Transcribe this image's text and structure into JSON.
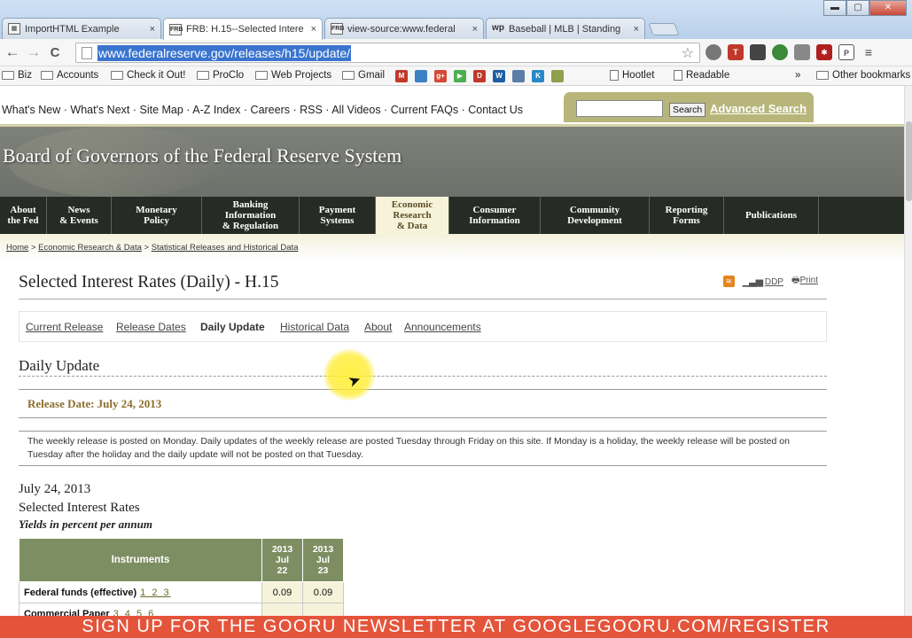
{
  "browser": {
    "tabs": [
      {
        "icon": "▦",
        "title": "ImportHTML Example",
        "close": "×"
      },
      {
        "icon": "FRB",
        "title": "FRB: H.15--Selected Intere",
        "close": "×"
      },
      {
        "icon": "FRB",
        "title": "view-source:www.federal",
        "close": "×"
      },
      {
        "icon": "wp",
        "title": "Baseball | MLB | Standing",
        "close": "×"
      }
    ],
    "window_controls": {
      "minimize": "▬",
      "maximize": "▢",
      "close": "✕"
    },
    "nav": {
      "back": "←",
      "forward": "→",
      "reload": "C"
    },
    "url": "www.federalreserve.gov/releases/h15/update/",
    "star": "☆",
    "bookmarks": [
      {
        "label": "Biz"
      },
      {
        "label": "Accounts"
      },
      {
        "label": "Check it Out!"
      },
      {
        "label": "ProClo"
      },
      {
        "label": "Web Projects"
      },
      {
        "label": "Gmail"
      },
      {
        "label": "Hootlet"
      },
      {
        "label": "Readable"
      },
      {
        "label": "»"
      },
      {
        "label": "Other bookmarks"
      }
    ]
  },
  "site": {
    "utility_links": "What's New · What's Next · Site Map · A-Z Index · Careers · RSS · All Videos · Current FAQs · Contact Us",
    "search_button": "Search",
    "advanced_search": "Advanced Search",
    "title": "Board of Governors of the Federal Reserve System",
    "nav": [
      {
        "label": "About\nthe Fed"
      },
      {
        "label": "News\n& Events"
      },
      {
        "label": "Monetary\nPolicy"
      },
      {
        "label": "Banking\nInformation\n& Regulation"
      },
      {
        "label": "Payment\nSystems"
      },
      {
        "label": "Economic\nResearch\n& Data"
      },
      {
        "label": "Consumer\nInformation"
      },
      {
        "label": "Community\nDevelopment"
      },
      {
        "label": "Reporting\nForms"
      },
      {
        "label": "Publications"
      }
    ],
    "breadcrumb": {
      "home": "Home",
      "sep": " > ",
      "level1": "Economic Research & Data",
      "level2": "Statistical Releases and Historical Data"
    }
  },
  "page": {
    "title": "Selected Interest Rates (Daily) - H.15",
    "tools": {
      "ddp": "DDP",
      "print": "Print"
    },
    "subnav": [
      {
        "label": "Current Release"
      },
      {
        "label": "Release Dates"
      },
      {
        "label": "Daily Update"
      },
      {
        "label": "Historical Data"
      },
      {
        "label": "About"
      },
      {
        "label": "Announcements"
      }
    ],
    "section_title": "Daily Update",
    "release_date": "Release Date: July 24, 2013",
    "notice": "The weekly release is posted on Monday. Daily updates of the weekly release are posted Tuesday through Friday on this site. If Monday is a holiday, the weekly release will be posted on Tuesday after the holiday and the daily update will not be posted on that Tuesday.",
    "report_date": "July 24, 2013",
    "report_name": "Selected Interest Rates",
    "report_units": "Yields in percent per annum",
    "table": {
      "header_instruments": "Instruments",
      "date_columns": [
        {
          "year": "2013",
          "month": "Jul",
          "day": "22"
        },
        {
          "year": "2013",
          "month": "Jul",
          "day": "23"
        }
      ],
      "rows": [
        {
          "name": "Federal funds (effective)",
          "notes": "1 2 3",
          "values": [
            "0.09",
            "0.09"
          ]
        },
        {
          "name": "Commercial Paper",
          "notes": "3 4 5 6",
          "values": [
            "",
            ""
          ]
        }
      ]
    }
  },
  "overlay": {
    "newsletter": "SIGN UP FOR THE GOORU NEWSLETTER AT GOOGLEGOORU.COM/REGISTER"
  }
}
